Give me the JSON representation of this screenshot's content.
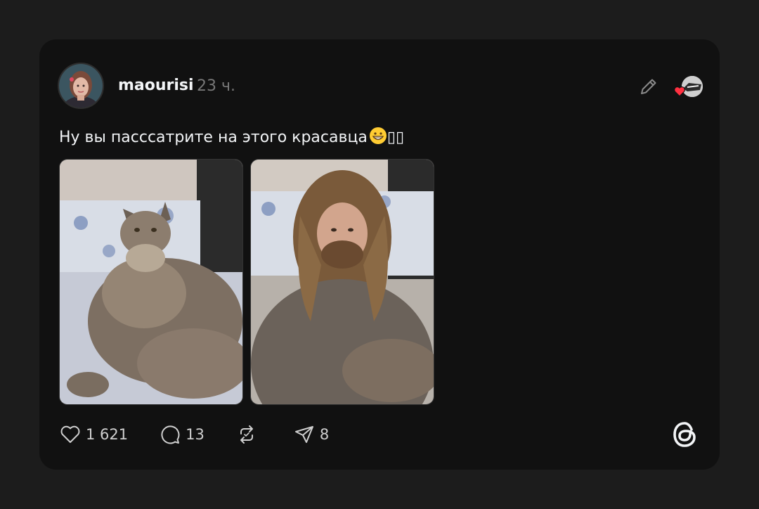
{
  "post": {
    "username": "maourisi",
    "time": "23 ч.",
    "text": "Ну вы пасссатрите на этого красавца",
    "trailing_emoji": "😁",
    "trailing_glyphs": "▯▯"
  },
  "actions": {
    "likes": "1 621",
    "comments": "13",
    "shares": "8"
  },
  "icons": {
    "edit": "pencil-icon",
    "like": "heart-icon",
    "comment": "comment-icon",
    "repost": "repost-icon",
    "share": "send-icon",
    "brand": "threads-logo-icon"
  },
  "colors": {
    "background": "#1c1c1c",
    "card": "#111111",
    "heart_badge": "#ff3040"
  }
}
